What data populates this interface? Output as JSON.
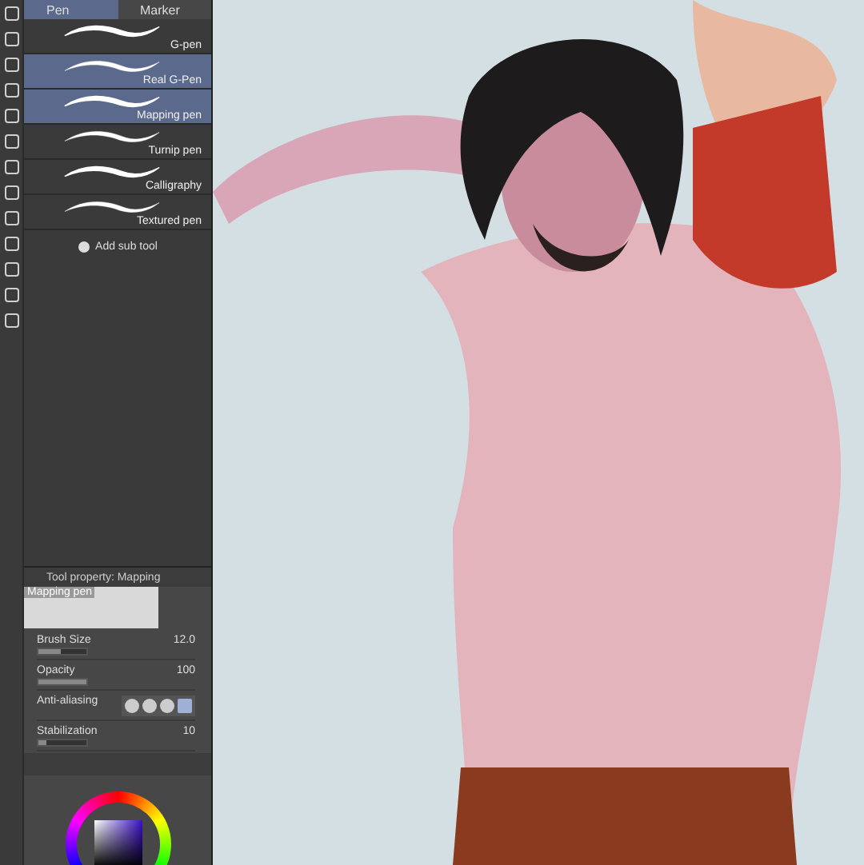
{
  "tabs": [
    {
      "label": "Pen",
      "selected": true
    },
    {
      "label": "Marker",
      "selected": false
    }
  ],
  "brushes": [
    {
      "name": "G-pen",
      "selected": false
    },
    {
      "name": "Real G-Pen",
      "selected": true
    },
    {
      "name": "Mapping pen",
      "selected": true
    },
    {
      "name": "Turnip pen",
      "selected": false
    },
    {
      "name": "Calligraphy",
      "selected": false
    },
    {
      "name": "Textured pen",
      "selected": false
    }
  ],
  "add_sub_tool": "Add sub tool",
  "tool_property": {
    "title": "Tool property: Mapping",
    "preview_label": "Mapping pen",
    "rows": [
      {
        "kind": "slider",
        "label": "Brush Size",
        "value": "12.0",
        "level": 0.45
      },
      {
        "kind": "slider",
        "label": "Opacity",
        "value": "100",
        "level": 1
      },
      {
        "kind": "choices",
        "label": "Anti-aliasing",
        "options": [
          {
            "selected": false
          },
          {
            "selected": false
          },
          {
            "selected": false
          },
          {
            "selected": true
          }
        ]
      },
      {
        "kind": "slider",
        "label": "Stabilization",
        "value": "10",
        "level": 0.15
      }
    ]
  }
}
